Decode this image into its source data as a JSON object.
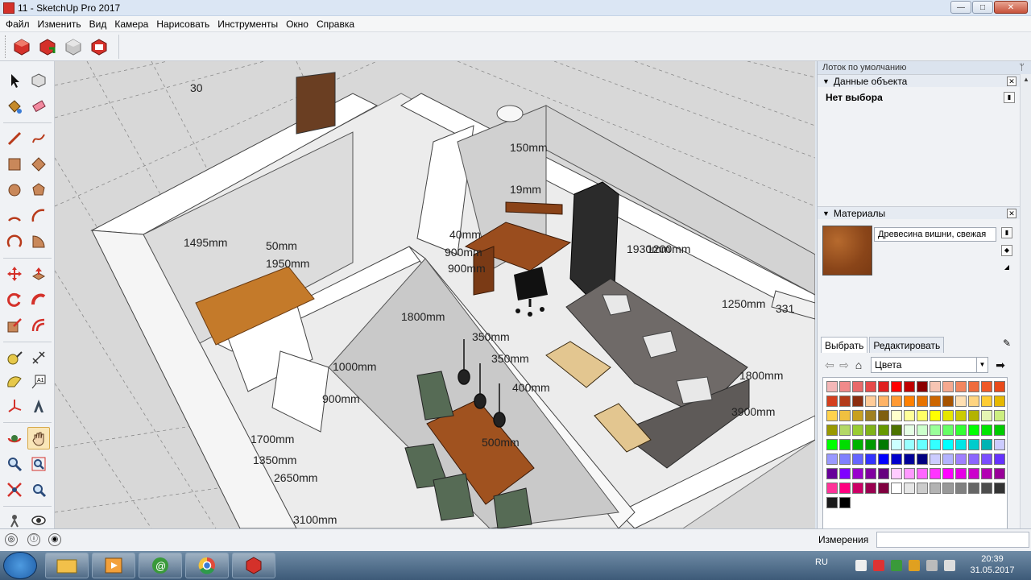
{
  "window": {
    "title": "11 - SketchUp Pro 2017",
    "min": "—",
    "max": "□",
    "close": "✕"
  },
  "menu": [
    "Файл",
    "Изменить",
    "Вид",
    "Камера",
    "Нарисовать",
    "Инструменты",
    "Окно",
    "Справка"
  ],
  "tray": {
    "title": "Лоток по умолчанию",
    "pin": "ᛘ",
    "entity_info": {
      "header": "Данные объекта",
      "selection": "Нет выбора"
    },
    "materials": {
      "header": "Материалы",
      "current_name": "Древесина вишни, свежая",
      "current_color": "#8a4519",
      "tabs": [
        "Выбрать",
        "Редактировать"
      ],
      "library": "Цвета",
      "palette": [
        "#f4b7b7",
        "#f08a8a",
        "#e86a6a",
        "#e64a4a",
        "#e02020",
        "#ff0000",
        "#c00000",
        "#8b0000",
        "#f7c5b3",
        "#f5a98f",
        "#f2865f",
        "#ef6b3c",
        "#f05a28",
        "#e94a1a",
        "#d43f1e",
        "#b33b1a",
        "#8b2e10",
        "#ffcc99",
        "#ffb366",
        "#ff9933",
        "#ff8000",
        "#e67300",
        "#cc6600",
        "#a65300",
        "#ffe0b3",
        "#ffd480",
        "#ffcc33",
        "#e6b800",
        "#ffd24d",
        "#f0c040",
        "#c8a020",
        "#a08020",
        "#806010",
        "#ffffcc",
        "#ffff99",
        "#ffff66",
        "#ffff00",
        "#e6e600",
        "#cccc00",
        "#b3b300",
        "#e6f5b3",
        "#ccee80",
        "#999900",
        "#b3d966",
        "#99cc33",
        "#80b31a",
        "#669900",
        "#4d7300",
        "#e6ffe6",
        "#ccffcc",
        "#99ff99",
        "#66ff66",
        "#33ff33",
        "#00ff00",
        "#00e600",
        "#00cc00",
        "#00ff00",
        "#00dd00",
        "#00b300",
        "#009900",
        "#007a00",
        "#ccffff",
        "#99ffff",
        "#66ffff",
        "#33ffff",
        "#00ffff",
        "#00e6e6",
        "#00cccc",
        "#00b3b3",
        "#ccccff",
        "#9999ff",
        "#8080ff",
        "#6666ff",
        "#3333ff",
        "#0000ff",
        "#0000cc",
        "#000099",
        "#000080",
        "#ccccff",
        "#b3b3ff",
        "#a080ff",
        "#8c66ff",
        "#7a4dff",
        "#6633ff",
        "#660099",
        "#7f00ff",
        "#9900cc",
        "#8000a0",
        "#660080",
        "#ffccff",
        "#ff99ff",
        "#ff66ff",
        "#ff33ff",
        "#ff00ff",
        "#e600e6",
        "#cc00cc",
        "#b300b3",
        "#990099",
        "#ff3399",
        "#ff0080",
        "#cc0066",
        "#990050",
        "#800040",
        "#ffffff",
        "#e6e6e6",
        "#cccccc",
        "#b3b3b3",
        "#999999",
        "#808080",
        "#666666",
        "#4d4d4d",
        "#333333",
        "#1a1a1a",
        "#000000"
      ]
    }
  },
  "viewport": {
    "dimensions": [
      "30",
      "1495mm",
      "50mm",
      "1950mm",
      "150mm",
      "19mm",
      "40mm",
      "900mm",
      "900mm",
      "1930mm",
      "1200mm",
      "1250mm",
      "331",
      "1800mm",
      "350mm",
      "350mm",
      "1000mm",
      "900mm",
      "400mm",
      "500mm",
      "1700mm",
      "1350mm",
      "2650mm",
      "3100mm",
      "1800mm",
      "3900mm"
    ]
  },
  "status": {
    "measurements_label": "Измерения",
    "measurements_value": ""
  },
  "taskbar": {
    "lang": "RU",
    "time": "20:39",
    "date": "31.05.2017"
  }
}
